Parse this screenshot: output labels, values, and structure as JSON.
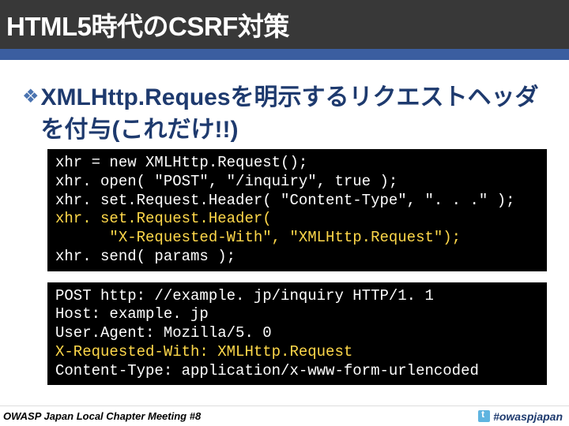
{
  "header": {
    "title": "HTML5時代のCSRF対策"
  },
  "bullet": {
    "text": "XMLHttp.Requesを明示するリクエストヘッダを付与(これだけ!!)"
  },
  "code1": {
    "l1": "xhr = new XMLHttp.Request();",
    "l2": "xhr. open( \"POST\", \"/inquiry\", true );",
    "l3": "xhr. set.Request.Header( \"Content-Type\", \". . .\" );",
    "l4a": "xhr. set.Request.Header(",
    "l4b": "      \"X-Requested-With\", \"XMLHttp.Request\");",
    "l5": "xhr. send( params );"
  },
  "code2": {
    "l1": "POST http: //example. jp/inquiry HTTP/1. 1",
    "l2": "Host: example. jp",
    "l3": "User.Agent: Mozilla/5. 0",
    "l4": "X-Requested-With: XMLHttp.Request",
    "l5": "Content-Type: application/x-www-form-urlencoded"
  },
  "footer": {
    "left": "OWASP Japan Local Chapter Meeting #8",
    "hashtag": "#owaspjapan"
  }
}
